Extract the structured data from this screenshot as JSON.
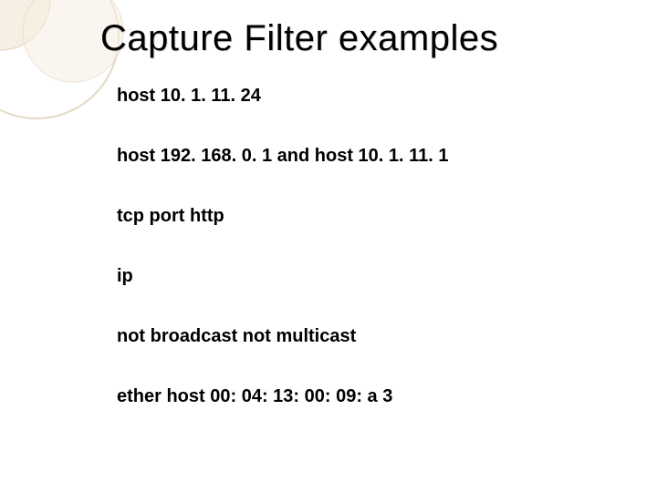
{
  "title": "Capture Filter examples",
  "examples": [
    "host 10. 1. 11. 24",
    "host 192. 168. 0. 1 and host 10. 1. 11. 1",
    "tcp port http",
    "ip",
    "not broadcast not multicast",
    "ether host 00: 04: 13: 00: 09: a 3"
  ]
}
